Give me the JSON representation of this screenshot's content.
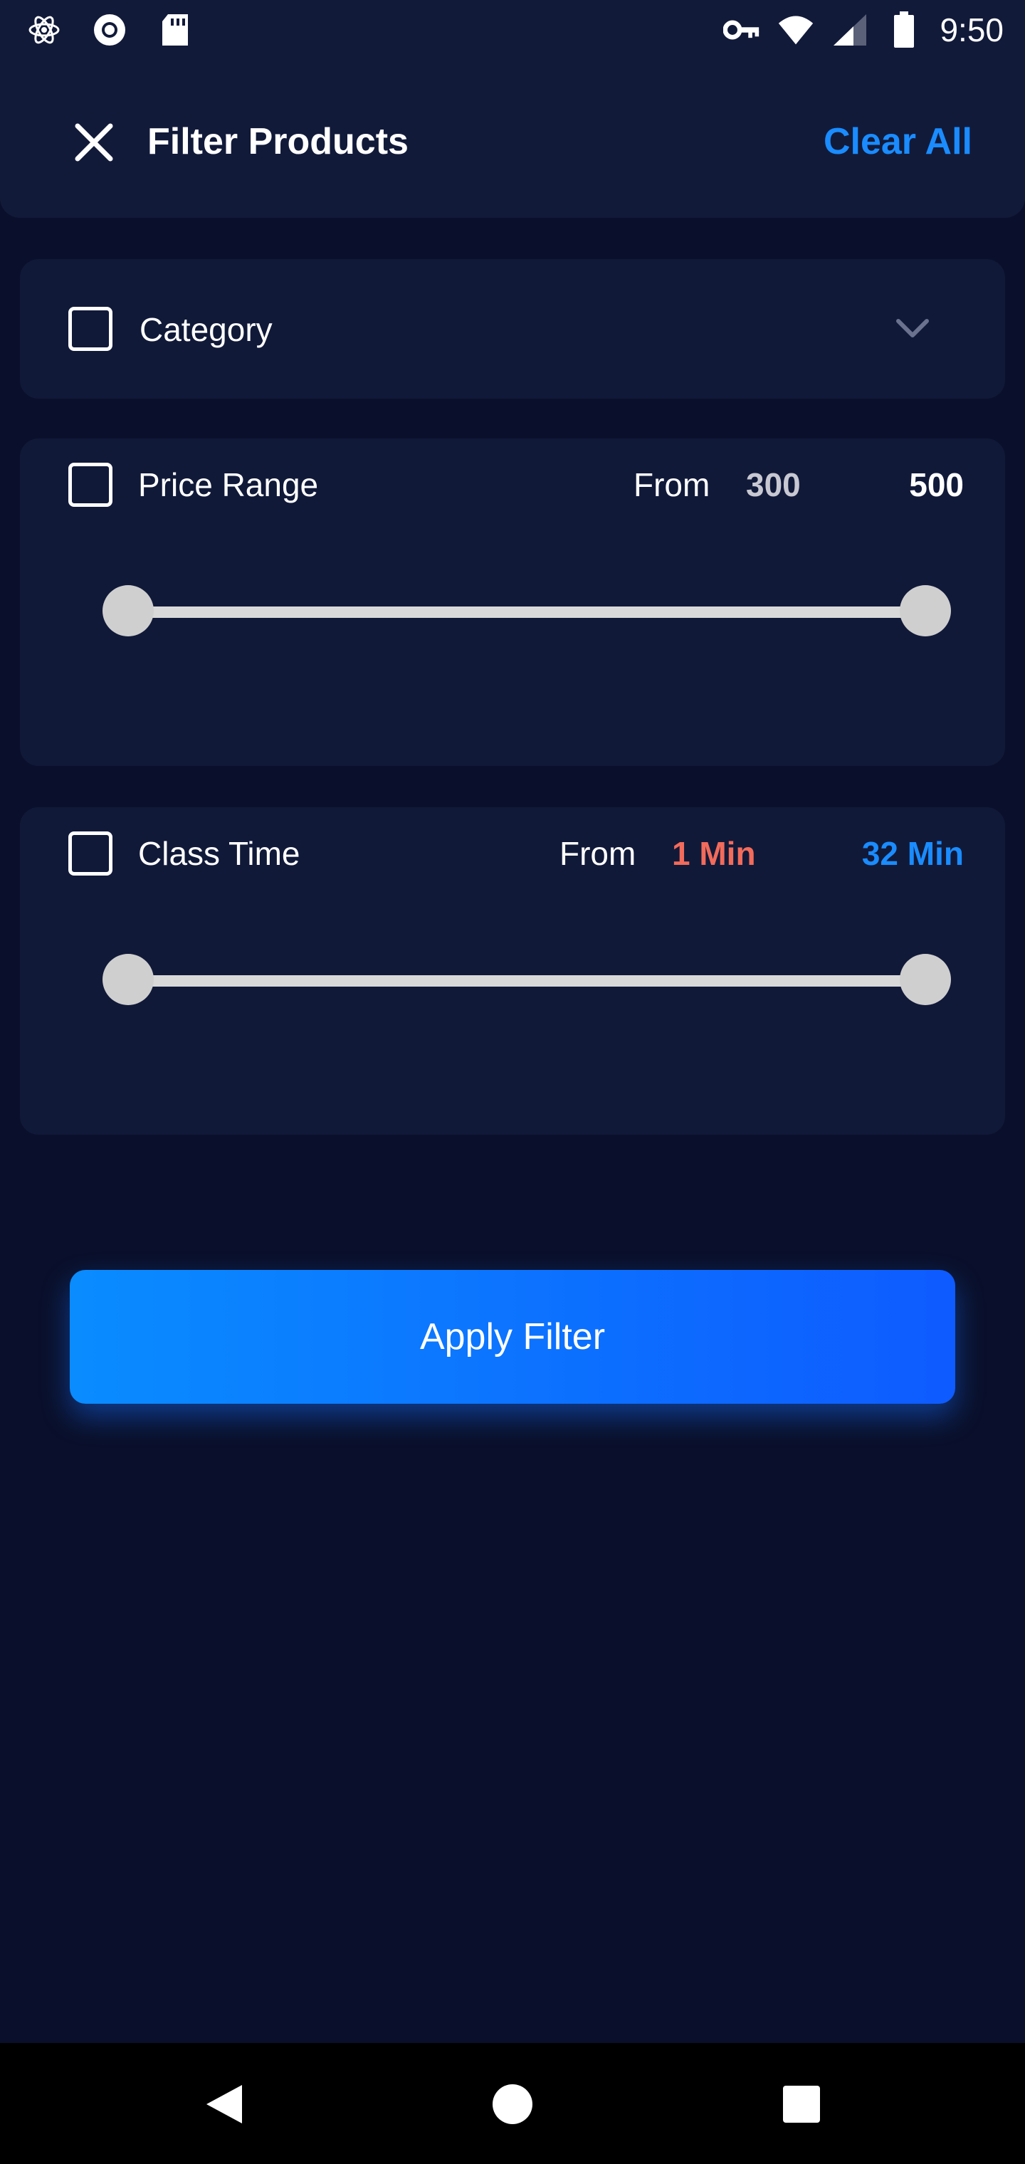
{
  "status_bar": {
    "time": "9:50",
    "left_icons": [
      "atom-icon",
      "record-icon",
      "sd-card-icon"
    ],
    "right_icons": [
      "key-icon",
      "wifi-icon",
      "signal-icon",
      "battery-icon"
    ]
  },
  "header": {
    "title": "Filter Products",
    "clear_all": "Clear All",
    "accent_color": "#1a8cff"
  },
  "filters": {
    "category": {
      "label": "Category",
      "checked": false
    },
    "price_range": {
      "label": "Price Range",
      "checked": false,
      "from_label": "From",
      "min": "300",
      "max": "500",
      "min_color": "#c8c8d2",
      "max_color": "#ffffff",
      "slider_low_fraction": 0,
      "slider_high_fraction": 1
    },
    "class_time": {
      "label": "Class Time",
      "checked": false,
      "from_label": "From",
      "min": "1 Min",
      "max": "32 Min",
      "min_color": "#f26b5b",
      "max_color": "#1a8cff",
      "slider_low_fraction": 0,
      "slider_high_fraction": 1
    }
  },
  "apply_button": {
    "label": "Apply Filter"
  },
  "nav_bar": {
    "buttons": [
      "back-icon",
      "home-icon",
      "recents-icon"
    ]
  }
}
